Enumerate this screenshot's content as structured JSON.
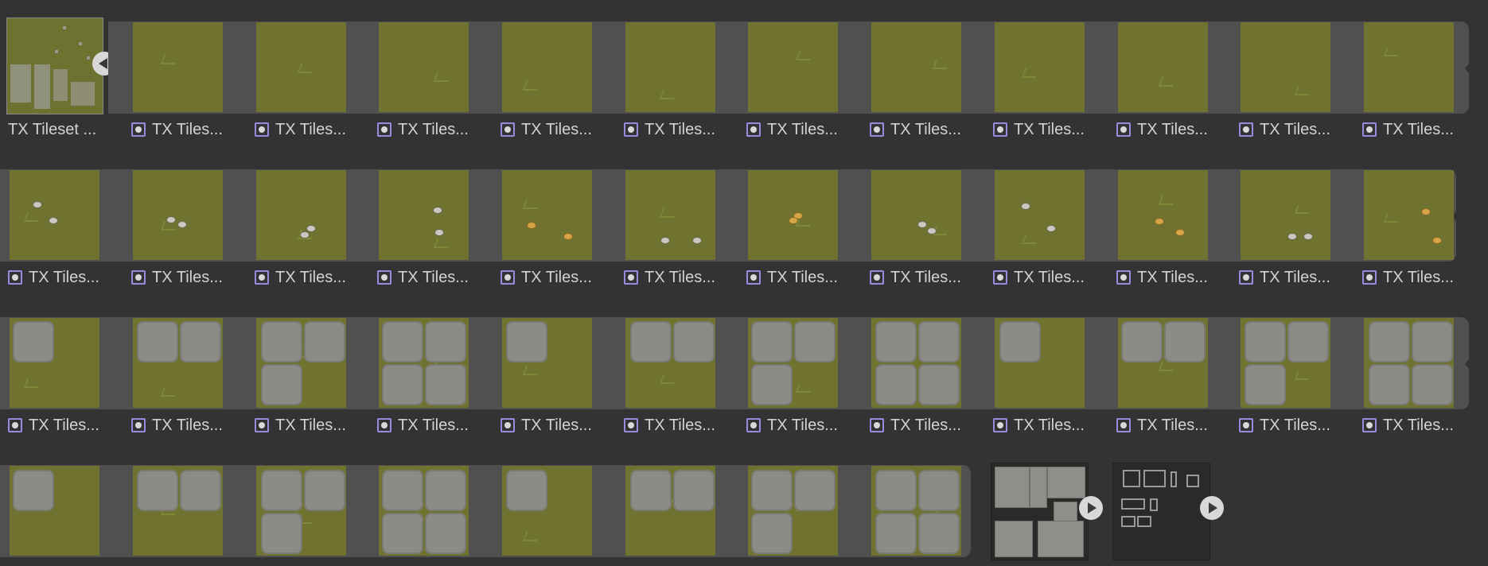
{
  "tileset": {
    "label": "TX Tileset ...",
    "collapse_icon": "chevron-left-icon"
  },
  "tile_label": "TX Tiles...",
  "tile_icon": "sprite-icon",
  "rows": [
    {
      "name": "row-1",
      "count": 11
    },
    {
      "name": "row-2",
      "count": 12
    },
    {
      "name": "row-3",
      "count": 12
    },
    {
      "name": "row-4",
      "count": 8
    }
  ],
  "assets": [
    {
      "name": "tilemap-thumbnail",
      "expand_icon": "play-icon"
    },
    {
      "name": "props-thumbnail",
      "expand_icon": "play-icon"
    }
  ],
  "colors": {
    "background": "#333333",
    "strip": "#505050",
    "grass": "#6f732f",
    "stone": "#8c8c86",
    "icon_accent": "#9a8be0"
  }
}
